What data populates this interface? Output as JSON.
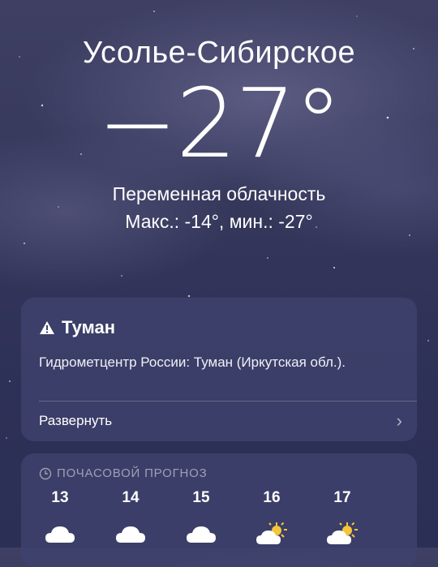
{
  "location": {
    "city": "Усолье-Сибирское",
    "temperature": "−27°",
    "condition": "Переменная облачность",
    "hi_lo": "Макс.: -14°, мин.: -27°"
  },
  "alert": {
    "title": "Туман",
    "icon": "warning-icon",
    "body": "Гидрометцентр России: Туман (Иркутская обл.).",
    "expand_label": "Развернуть"
  },
  "hourly": {
    "header": "ПОЧАСОВОЙ ПРОГНОЗ",
    "icon": "clock-icon",
    "items": [
      {
        "hour": "13",
        "icon": "cloud-icon"
      },
      {
        "hour": "14",
        "icon": "cloud-icon"
      },
      {
        "hour": "15",
        "icon": "cloud-icon"
      },
      {
        "hour": "16",
        "icon": "partly-sunny-icon"
      },
      {
        "hour": "17",
        "icon": "partly-sunny-icon"
      }
    ]
  },
  "colors": {
    "background": "#34365a",
    "card": "#3e426c",
    "sun": "#f5c53a"
  }
}
